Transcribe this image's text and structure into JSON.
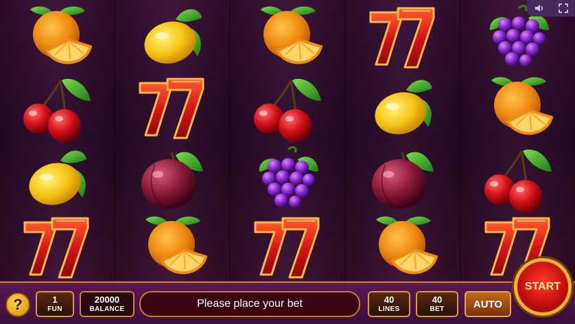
{
  "top_controls": {
    "sound_icon": "speaker-icon",
    "fullscreen_icon": "fullscreen-icon"
  },
  "reels": [
    [
      "orange",
      "cherry",
      "lemon",
      "seven"
    ],
    [
      "lemon",
      "seven",
      "plum",
      "orange"
    ],
    [
      "orange",
      "cherry",
      "grapes",
      "seven"
    ],
    [
      "seven",
      "lemon",
      "plum",
      "orange"
    ],
    [
      "grapes",
      "orange",
      "cherry",
      "seven"
    ]
  ],
  "panel": {
    "help_label": "?",
    "fun": {
      "value": "1",
      "label": "FUN"
    },
    "balance": {
      "value": "20000",
      "label": "BALANCE"
    },
    "message": "Please place your bet",
    "lines": {
      "value": "40",
      "label": "LINES"
    },
    "bet": {
      "value": "40",
      "label": "BET"
    },
    "auto_label": "AUTO",
    "start_label": "START"
  },
  "colors": {
    "accent_gold": "#d99a3a",
    "start_red": "#c8100e",
    "background": "#2a0b26"
  }
}
